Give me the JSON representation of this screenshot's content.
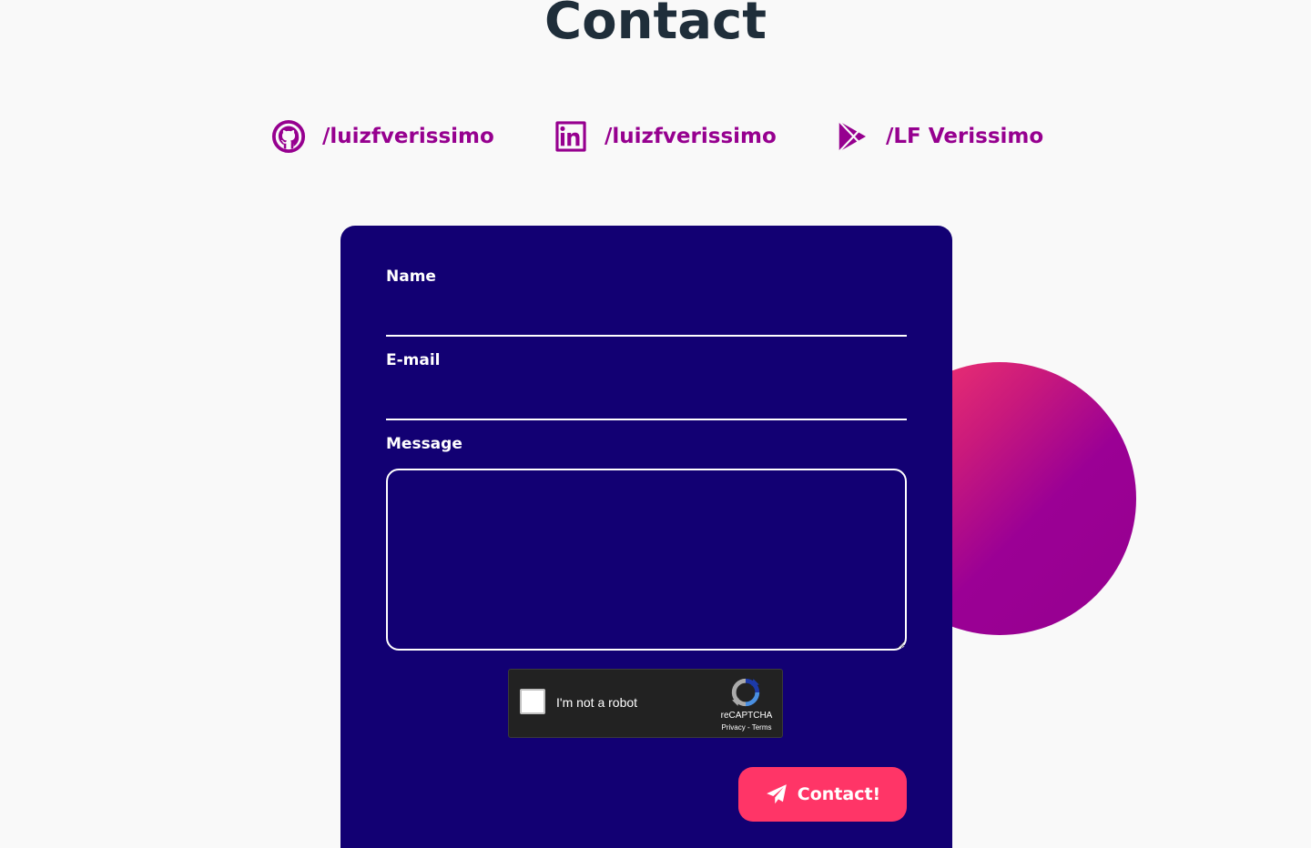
{
  "page": {
    "title": "Contact"
  },
  "social": [
    {
      "icon": "github-icon",
      "label": "/luizfverissimo"
    },
    {
      "icon": "linkedin-icon",
      "label": "/luizfverissimo"
    },
    {
      "icon": "play-store-icon",
      "label": "/LF Verissimo"
    }
  ],
  "form": {
    "name_label": "Name",
    "name_value": "",
    "email_label": "E-mail",
    "email_value": "",
    "message_label": "Message",
    "message_value": "",
    "submit_label": "Contact!",
    "submit_icon": "paper-plane-icon"
  },
  "recaptcha": {
    "label": "I'm not a robot",
    "brand": "reCAPTCHA",
    "privacy": "Privacy",
    "separator": " - ",
    "terms": "Terms",
    "checked": false
  },
  "colors": {
    "background": "#f9f9f9",
    "title": "#1f2e3a",
    "accent_purple": "#96008f",
    "form_background": "#120073",
    "button": "#ff3567",
    "blob_gradient": [
      "#ff3d6b",
      "#96008f"
    ]
  }
}
